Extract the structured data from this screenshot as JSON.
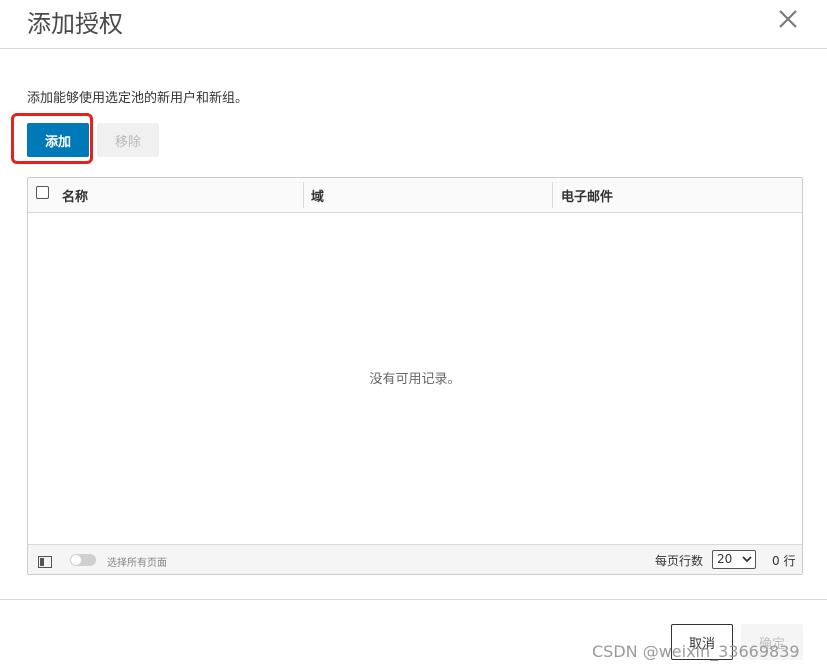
{
  "dialog": {
    "title": "添加授权",
    "description": "添加能够使用选定池的新用户和新组。"
  },
  "toolbar": {
    "add_label": "添加",
    "remove_label": "移除"
  },
  "grid": {
    "columns": [
      "名称",
      "域",
      "电子邮件"
    ],
    "empty_message": "没有可用记录。",
    "footer": {
      "select_all_pages_label": "选择所有页面",
      "rows_per_page_label": "每页行数",
      "page_size": "20",
      "row_count": "0 行"
    }
  },
  "actions": {
    "cancel_label": "取消",
    "ok_label": "确定"
  },
  "watermark": "CSDN @weixin_33669839",
  "colors": {
    "primary": "#0079b8",
    "highlight": "#e8201c"
  },
  "icons": [
    "close-icon",
    "column-toggle-icon",
    "chevron-down-icon"
  ]
}
